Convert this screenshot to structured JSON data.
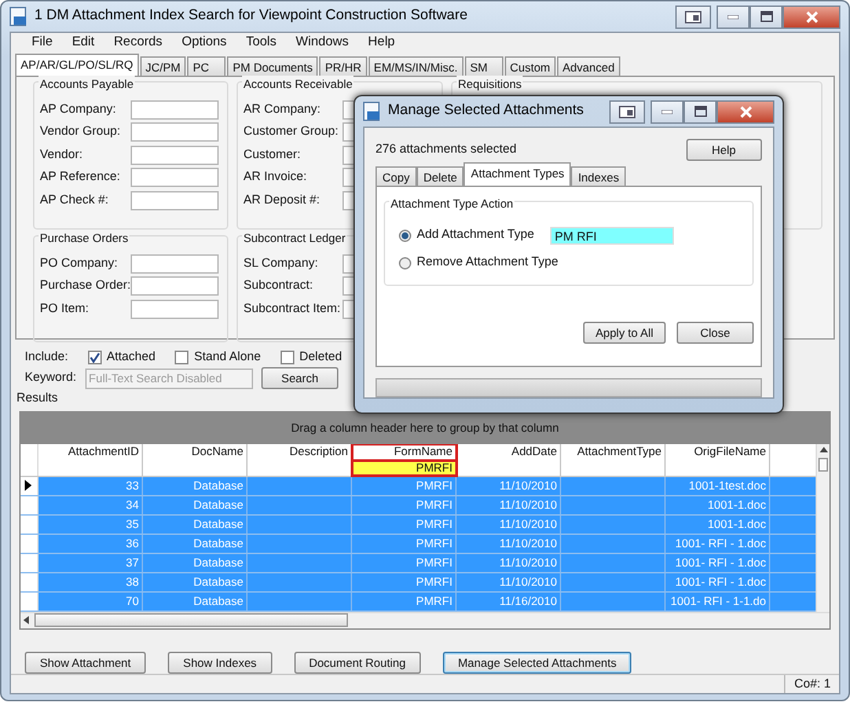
{
  "window": {
    "title": "1 DM Attachment Index Search for Viewpoint Construction Software"
  },
  "menu": [
    "File",
    "Edit",
    "Records",
    "Options",
    "Tools",
    "Windows",
    "Help"
  ],
  "tabs": [
    {
      "label": "AP/AR/GL/PO/SL/RQ",
      "selected": true
    },
    {
      "label": "JC/PM",
      "selected": false
    },
    {
      "label": "PC",
      "selected": false
    },
    {
      "label": "PM Documents",
      "selected": false
    },
    {
      "label": "PR/HR",
      "selected": false
    },
    {
      "label": "EM/MS/IN/Misc.",
      "selected": false
    },
    {
      "label": "SM",
      "selected": false
    },
    {
      "label": "Custom",
      "selected": false
    },
    {
      "label": "Advanced",
      "selected": false
    }
  ],
  "groups": [
    {
      "title": "Accounts Payable",
      "fields": [
        "AP Company:",
        "Vendor Group:",
        "Vendor:",
        "AP Reference:",
        "AP Check #:"
      ]
    },
    {
      "title": "Accounts Receivable",
      "fields": [
        "AR Company:",
        "Customer Group:",
        "Customer:",
        "AR Invoice:",
        "AR Deposit #:"
      ]
    },
    {
      "title": "Requisitions"
    },
    {
      "title": "Purchase Orders",
      "fields": [
        "PO Company:",
        "Purchase Order:",
        "PO Item:"
      ]
    },
    {
      "title": "Subcontract Ledger",
      "fields": [
        "SL Company:",
        "Subcontract:",
        "Subcontract Item:"
      ]
    }
  ],
  "include": {
    "label": "Include:",
    "options": [
      {
        "label": "Attached",
        "checked": true
      },
      {
        "label": "Stand Alone",
        "checked": false
      },
      {
        "label": "Deleted",
        "checked": false
      }
    ]
  },
  "keyword": {
    "label": "Keyword:",
    "placeholder": "Full-Text Search Disabled"
  },
  "search_button": "Search",
  "results": {
    "label": "Results",
    "group_hint": "Drag a column header here to group by that column",
    "columns": [
      {
        "label": "AttachmentID"
      },
      {
        "label": "DocName"
      },
      {
        "label": "Description"
      },
      {
        "label": "FormName",
        "filter": "PMRFI",
        "highlighted": true
      },
      {
        "label": "AddDate"
      },
      {
        "label": "AttachmentType"
      },
      {
        "label": "OrigFileName"
      }
    ],
    "rows": [
      {
        "cells": [
          "33",
          "Database",
          "",
          "PMRFI",
          "11/10/2010",
          "",
          "1001-1test.doc"
        ],
        "selected": true,
        "current": true
      },
      {
        "cells": [
          "34",
          "Database",
          "",
          "PMRFI",
          "11/10/2010",
          "",
          "1001-1.doc"
        ],
        "selected": true,
        "current": false
      },
      {
        "cells": [
          "35",
          "Database",
          "",
          "PMRFI",
          "11/10/2010",
          "",
          "1001-1.doc"
        ],
        "selected": true,
        "current": false
      },
      {
        "cells": [
          "36",
          "Database",
          "",
          "PMRFI",
          "11/10/2010",
          "",
          "1001- RFI - 1.doc"
        ],
        "selected": true,
        "current": false
      },
      {
        "cells": [
          "37",
          "Database",
          "",
          "PMRFI",
          "11/10/2010",
          "",
          "1001- RFI - 1.doc"
        ],
        "selected": true,
        "current": false
      },
      {
        "cells": [
          "38",
          "Database",
          "",
          "PMRFI",
          "11/10/2010",
          "",
          "1001- RFI - 1.doc"
        ],
        "selected": true,
        "current": false
      },
      {
        "cells": [
          "70",
          "Database",
          "",
          "PMRFI",
          "11/16/2010",
          "",
          "1001- RFI - 1-1.do"
        ],
        "selected": true,
        "current": false
      }
    ]
  },
  "buttons": [
    {
      "label": "Show Attachment",
      "focused": false
    },
    {
      "label": "Show Indexes",
      "focused": false
    },
    {
      "label": "Document Routing",
      "focused": false
    },
    {
      "label": "Manage Selected Attachments",
      "focused": true
    }
  ],
  "status_bar": "Co#: 1",
  "dialog": {
    "title": "Manage Selected Attachments",
    "summary": "276 attachments selected",
    "help": "Help",
    "tabs": [
      {
        "label": "Copy",
        "selected": false
      },
      {
        "label": "Delete",
        "selected": false
      },
      {
        "label": "Attachment Types",
        "selected": true
      },
      {
        "label": "Indexes",
        "selected": false
      }
    ],
    "group_title": "Attachment Type Action",
    "options": [
      {
        "label": "Add Attachment Type",
        "selected": true,
        "value": "PM RFI"
      },
      {
        "label": "Remove Attachment Type",
        "selected": false
      }
    ],
    "buttons": [
      "Apply to All",
      "Close"
    ],
    "progress": {
      "level": 0
    }
  }
}
